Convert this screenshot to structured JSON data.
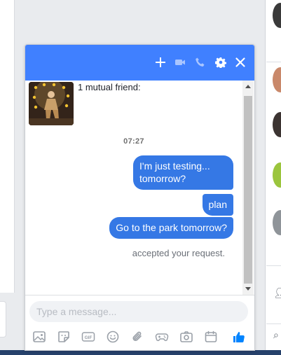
{
  "chat": {
    "mutual_friends": "1 mutual friend:",
    "timestamp": "07:27",
    "messages": [
      {
        "text": "I'm just testing... tomorrow?"
      },
      {
        "text": "plan"
      },
      {
        "text": "Go to the park tomorrow?"
      }
    ],
    "status_text": "accepted your request.",
    "input_placeholder": "Type a message...",
    "header_icons": [
      "plus-icon",
      "video-camera-icon",
      "phone-icon",
      "gear-icon",
      "close-icon"
    ],
    "toolbar_icons": [
      "photo-icon",
      "sticker-icon",
      "gif-icon",
      "emoji-icon",
      "attachment-icon",
      "game-controller-icon",
      "camera-icon",
      "calendar-icon",
      "thumbs-up-icon"
    ]
  },
  "colors": {
    "header_bg": "#4080ff",
    "bubble_bg": "#3578e5",
    "accent": "#0084ff"
  },
  "gif_label": "GIF"
}
